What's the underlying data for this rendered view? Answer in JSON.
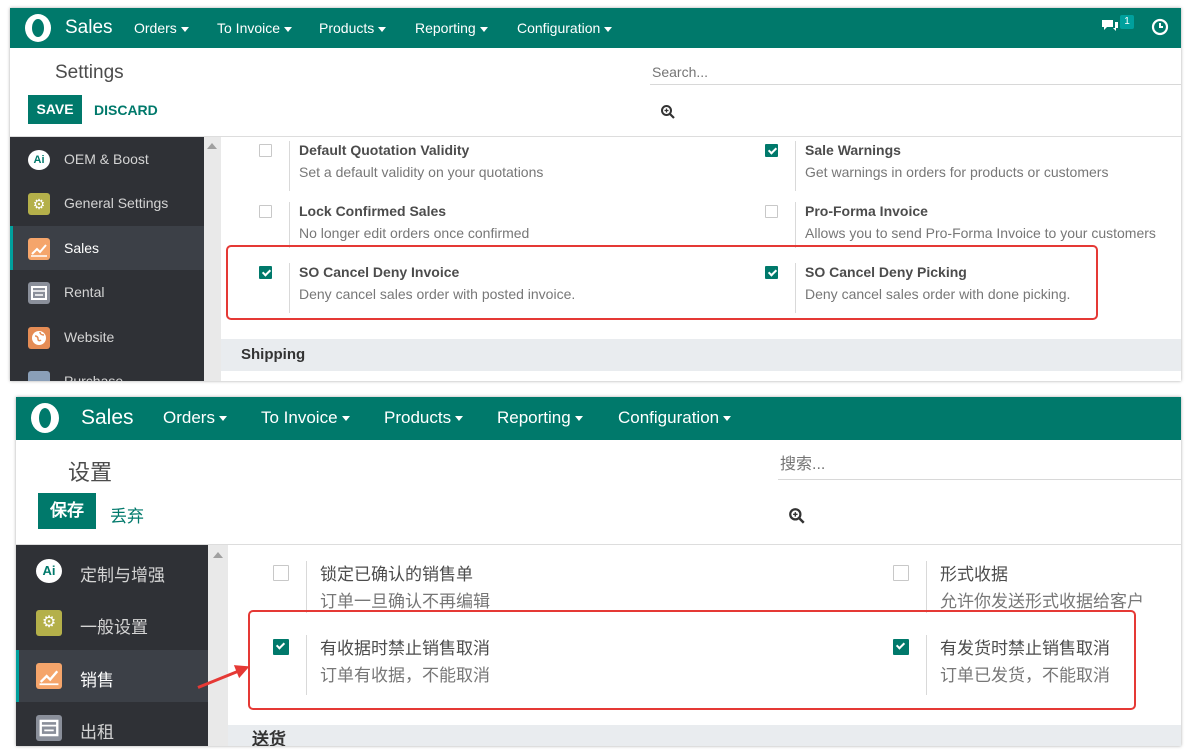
{
  "colors": {
    "brand": "#00796b",
    "sidebar": "#2f3136",
    "highlight": "#e53935"
  },
  "en": {
    "navbar": {
      "app_name": "Sales",
      "menus": [
        "Orders",
        "To Invoice",
        "Products",
        "Reporting",
        "Configuration"
      ],
      "chat_badge": "1",
      "icons": [
        "chat-icon",
        "clock-icon"
      ]
    },
    "page_title": "Settings",
    "save_label": "SAVE",
    "discard_label": "DISCARD",
    "search": {
      "placeholder": "Search..."
    },
    "sidebar": [
      {
        "label": "OEM & Boost",
        "icon": "oem-boost-icon"
      },
      {
        "label": "General Settings",
        "icon": "gear-icon"
      },
      {
        "label": "Sales",
        "icon": "chart-icon",
        "active": true
      },
      {
        "label": "Rental",
        "icon": "rental-icon"
      },
      {
        "label": "Website",
        "icon": "globe-icon"
      },
      {
        "label": "Purchase",
        "icon": "purchase-icon"
      }
    ],
    "settings": [
      {
        "title": "Default Quotation Validity",
        "desc": "Set a default validity on your quotations",
        "checked": false
      },
      {
        "title": "Sale Warnings",
        "desc": "Get warnings in orders for products or customers",
        "checked": true
      },
      {
        "title": "Lock Confirmed Sales",
        "desc": "No longer edit orders once confirmed",
        "checked": false
      },
      {
        "title": "Pro-Forma Invoice",
        "desc": "Allows you to send Pro-Forma Invoice to your customers",
        "checked": false
      },
      {
        "title": "SO Cancel Deny Invoice",
        "desc": "Deny cancel sales order with posted invoice.",
        "checked": true
      },
      {
        "title": "SO Cancel Deny Picking",
        "desc": "Deny cancel sales order with done picking.",
        "checked": true
      }
    ],
    "section_shipping": "Shipping"
  },
  "zh": {
    "navbar": {
      "app_name": "Sales",
      "menus": [
        "Orders",
        "To Invoice",
        "Products",
        "Reporting",
        "Configuration"
      ]
    },
    "page_title": "设置",
    "save_label": "保存",
    "discard_label": "丢弃",
    "search": {
      "placeholder": "搜索..."
    },
    "sidebar": [
      {
        "label": "定制与增强",
        "icon": "oem-boost-icon"
      },
      {
        "label": "一般设置",
        "icon": "gear-icon"
      },
      {
        "label": "销售",
        "icon": "chart-icon",
        "active": true
      },
      {
        "label": "出租",
        "icon": "rental-icon"
      }
    ],
    "settings": [
      {
        "title": "锁定已确认的销售单",
        "desc": "订单一旦确认不再编辑",
        "checked": false
      },
      {
        "title": "形式收据",
        "desc": "允许你发送形式收据给客户",
        "checked": false
      },
      {
        "title": "有收据时禁止销售取消",
        "desc": "订单有收据，不能取消",
        "checked": true
      },
      {
        "title": "有发货时禁止销售取消",
        "desc": "订单已发货，不能取消",
        "checked": true
      }
    ],
    "section_shipping": "送货"
  }
}
